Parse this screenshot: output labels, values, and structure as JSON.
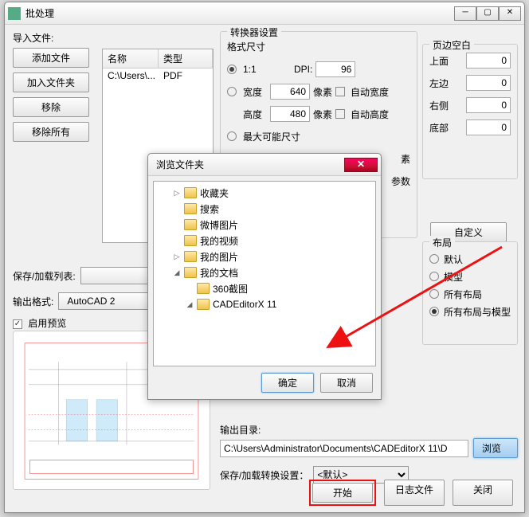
{
  "main": {
    "title": "批处理",
    "import_label": "导入文件:",
    "btn_add_file": "添加文件",
    "btn_add_folder": "加入文件夹",
    "btn_remove": "移除",
    "btn_remove_all": "移除所有",
    "file_hdr_name": "名称",
    "file_hdr_type": "类型",
    "file_row_name": "C:\\Users\\...",
    "file_row_type": "PDF",
    "save_list_label": "保存/加载列表:",
    "fmt_label": "输出格式:",
    "fmt_value": "AutoCAD 2",
    "enable_preview": "启用预览",
    "start": "开始",
    "logfiles": "日志文件",
    "close": "关闭"
  },
  "conv": {
    "title": "转换器设置",
    "size_title": "格式尺寸",
    "one_to_one": "1:1",
    "dpi_label": "DPI:",
    "dpi_value": "96",
    "width_lbl": "宽度",
    "width_val": "640",
    "px1": "像素",
    "auto_w": "自动宽度",
    "height_lbl": "高度",
    "height_val": "480",
    "px2": "像素",
    "auto_h": "自动高度",
    "max_size": "最大可能尺寸",
    "suffix1": "素",
    "suffix2": "参数"
  },
  "margin": {
    "title": "页边空白",
    "top": "上面",
    "top_v": "0",
    "left": "左边",
    "left_v": "0",
    "right": "右侧",
    "right_v": "0",
    "bottom": "底部",
    "bottom_v": "0"
  },
  "custom_btn": "自定义",
  "layout": {
    "title": "布局",
    "default": "默认",
    "model": "模型",
    "all": "所有布局",
    "all_model": "所有布局与模型"
  },
  "out": {
    "label": "输出目录:",
    "path": "C:\\Users\\Administrator\\Documents\\CADEditorX 11\\D",
    "browse": "浏览"
  },
  "settings": {
    "label": "保存/加载转换设置：",
    "value": "<默认>"
  },
  "dlg": {
    "title": "浏览文件夹",
    "ok": "确定",
    "cancel": "取消",
    "nodes": {
      "fav": "收藏夹",
      "search": "搜索",
      "weibo": "微博图片",
      "video": "我的视频",
      "pic": "我的图片",
      "doc": "我的文档",
      "shot": "360截图",
      "cad": "CADEditorX 11"
    }
  }
}
